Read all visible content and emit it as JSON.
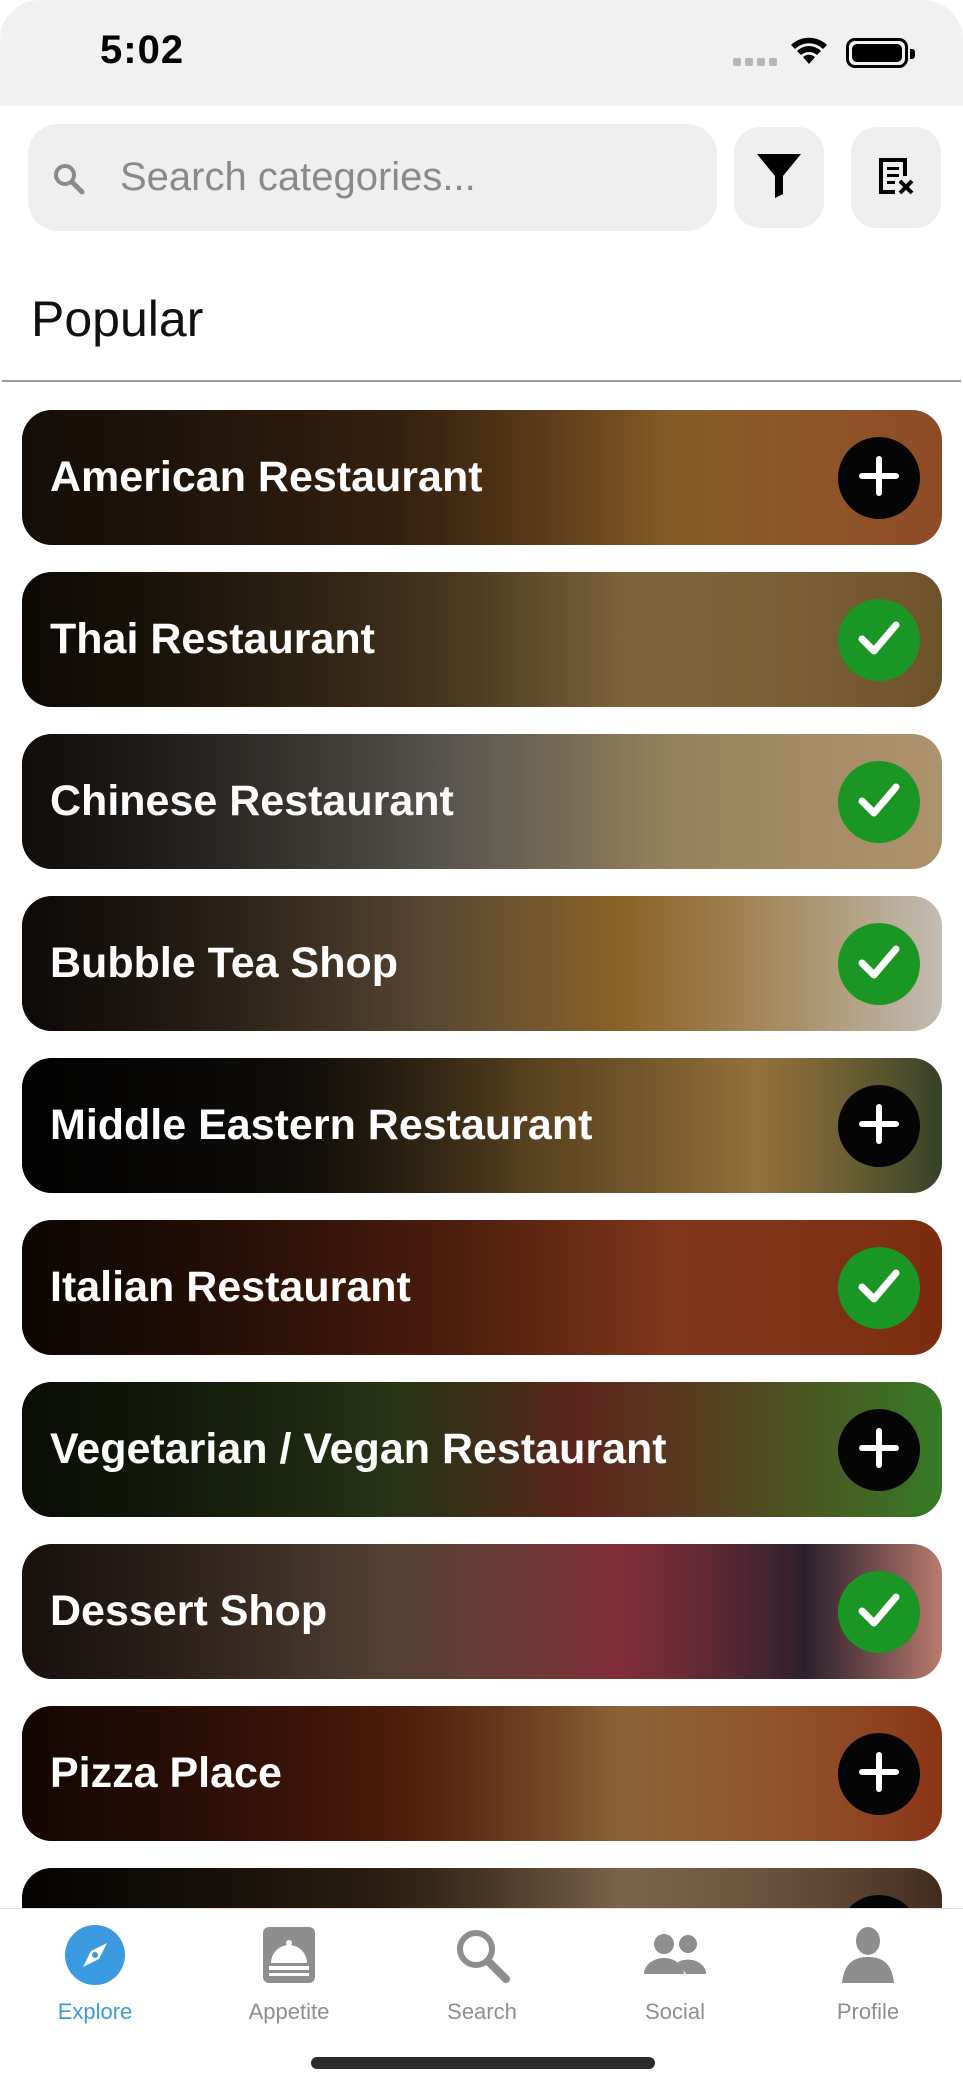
{
  "status_bar": {
    "time": "5:02"
  },
  "search": {
    "placeholder": "Search categories..."
  },
  "section": {
    "title": "Popular"
  },
  "categories": [
    {
      "label": "American Restaurant",
      "state": "add",
      "bg": "linear-gradient(90deg,#5a3a20 0%,#7b4a22 40%,#c98a3a 70%,#a0522d 100%)"
    },
    {
      "label": "Thai Restaurant",
      "state": "added",
      "bg": "linear-gradient(90deg,#3a2612 0%,#8b6a3a 40%,#c8a060 65%,#7a5a30 100%)"
    },
    {
      "label": "Chinese Restaurant",
      "state": "added",
      "bg": "linear-gradient(90deg,#4a3a30 0%,#bfb6aa 45%,#e2c48a 70%,#c2a27a 100%)"
    },
    {
      "label": "Bubble Tea Shop",
      "state": "added",
      "bg": "linear-gradient(90deg,#3a2a20 0%,#caa070 45%,#e0a040 65%,#d9d2c8 100%)"
    },
    {
      "label": "Middle Eastern Restaurant",
      "state": "add",
      "bg": "linear-gradient(90deg,#0a0a0a 0%,#2a2218 30%,#a57a3a 55%,#c89a50 80%,#3a4a2a 100%)"
    },
    {
      "label": "Italian Restaurant",
      "state": "added",
      "bg": "linear-gradient(90deg,#3a1a0a 0%,#9a3a1a 40%,#c2522a 70%,#8a3010 100%)"
    },
    {
      "label": "Vegetarian / Vegan Restaurant",
      "state": "add",
      "bg": "linear-gradient(90deg,#2a3a1a 0%,#5a7a30 40%,#a04030 60%,#3a8a2a 100%)"
    },
    {
      "label": "Dessert Shop",
      "state": "added",
      "bg": "linear-gradient(90deg,#6a4a3a 0%,#c89a7a 40%,#d24a5a 65%,#3a2a3a 85%,#d08a7a 100%)"
    },
    {
      "label": "Pizza Place",
      "state": "add",
      "bg": "linear-gradient(90deg,#5a1a0a 0%,#b2401a 40%,#e2a05a 65%,#9a3a1a 100%)"
    },
    {
      "label": "",
      "state": "add",
      "bg": "linear-gradient(90deg,#1a120a 0%,#6a4a2a 40%,#c8a07a 65%,#4a3020 100%)"
    }
  ],
  "tabs": [
    {
      "label": "Explore",
      "icon": "compass-icon",
      "active": true
    },
    {
      "label": "Appetite",
      "icon": "cloche-icon",
      "active": false
    },
    {
      "label": "Search",
      "icon": "search-icon",
      "active": false
    },
    {
      "label": "Social",
      "icon": "people-icon",
      "active": false
    },
    {
      "label": "Profile",
      "icon": "person-icon",
      "active": false
    }
  ],
  "colors": {
    "accent": "#3c9be0",
    "added": "#1a9624",
    "add": "#050505",
    "tab_inactive": "#8e8e8e"
  }
}
